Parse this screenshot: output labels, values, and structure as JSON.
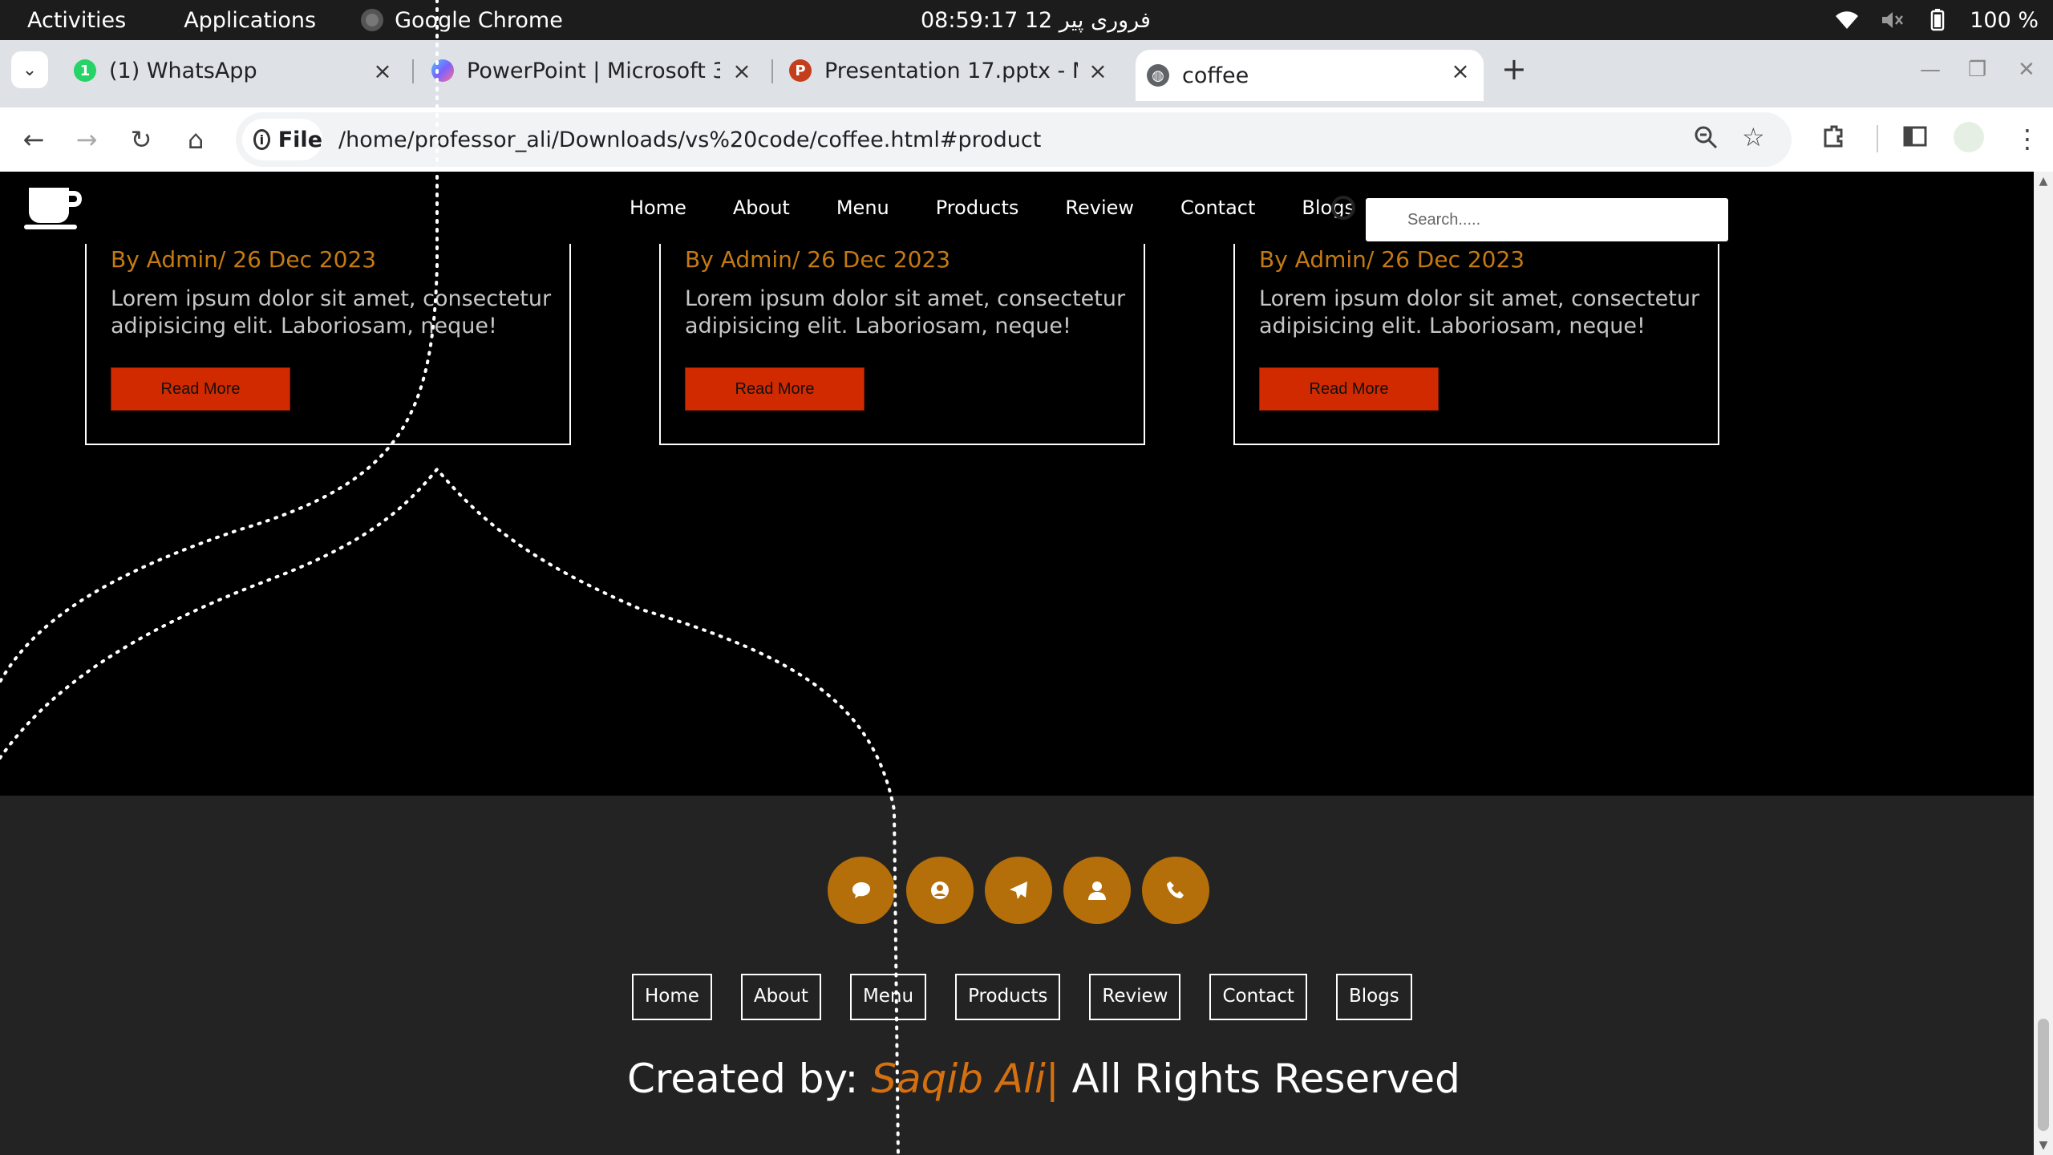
{
  "system_bar": {
    "activities": "Activities",
    "applications": "Applications",
    "active_app": "Google Chrome",
    "clock": "08:59:17  12 فروری پیر",
    "battery": "100 %"
  },
  "browser": {
    "tabs": [
      {
        "title": "(1) WhatsApp",
        "icon": "whatsapp-icon",
        "color": "#25d366"
      },
      {
        "title": "PowerPoint | Microsoft 3",
        "icon": "copilot-icon",
        "color": "#7b61ff"
      },
      {
        "title": "Presentation 17.pptx - M",
        "icon": "powerpoint-icon",
        "color": "#c43e1c"
      },
      {
        "title": "coffee",
        "icon": "globe-icon",
        "color": "#5f6368"
      }
    ],
    "omnibox": {
      "scheme_label": "File",
      "url": "/home/professor_ali/Downloads/vs%20code/coffee.html#product"
    }
  },
  "site": {
    "nav": [
      "Home",
      "About",
      "Menu",
      "Products",
      "Review",
      "Contact",
      "Blogs"
    ],
    "search_placeholder": "Search.....",
    "blogs": [
      {
        "meta": "By Admin/ 26 Dec 2023",
        "excerpt": "Lorem ipsum dolor sit amet, consectetur adipisicing elit. Laboriosam, neque!",
        "button": "Read More"
      },
      {
        "meta": "By Admin/ 26 Dec 2023",
        "excerpt": "Lorem ipsum dolor sit amet, consectetur adipisicing elit. Laboriosam, neque!",
        "button": "Read More"
      },
      {
        "meta": "By Admin/ 26 Dec 2023",
        "excerpt": "Lorem ipsum dolor sit amet, consectetur adipisicing elit. Laboriosam, neque!",
        "button": "Read More"
      }
    ],
    "footer": {
      "social_icons": [
        "chat-icon",
        "user-circle-icon",
        "send-icon",
        "user-icon",
        "phone-icon"
      ],
      "nav": [
        "Home",
        "About",
        "Menu",
        "Products",
        "Review",
        "Contact",
        "Blogs"
      ],
      "credit_prefix": "Created by:",
      "credit_author": "Saqib Ali",
      "credit_sep": "|",
      "credit_suffix": "All Rights Reserved"
    },
    "colors": {
      "accent": "#c47a12",
      "button": "#d12a00",
      "footer_bg": "#232323",
      "social_bg": "#b56f0a"
    }
  }
}
